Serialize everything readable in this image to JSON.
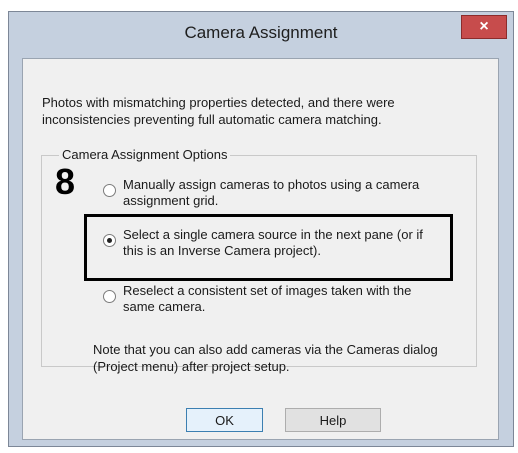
{
  "window": {
    "title": "Camera Assignment",
    "close_symbol": "×"
  },
  "message": "Photos with mismatching properties detected, and there were inconsistencies preventing full automatic camera matching.",
  "options_group": {
    "legend": "Camera Assignment Options",
    "step_number": "8",
    "options": [
      {
        "label": "Manually assign cameras to photos using a camera assignment grid.",
        "selected": false
      },
      {
        "label": "Select a single camera source in the next pane (or if this is an Inverse Camera project).",
        "selected": true
      },
      {
        "label": "Reselect a consistent set of images taken with the same camera.",
        "selected": false
      }
    ]
  },
  "note": "Note that you can also add cameras via the Cameras dialog (Project menu) after project setup.",
  "buttons": {
    "ok": "OK",
    "help": "Help"
  }
}
